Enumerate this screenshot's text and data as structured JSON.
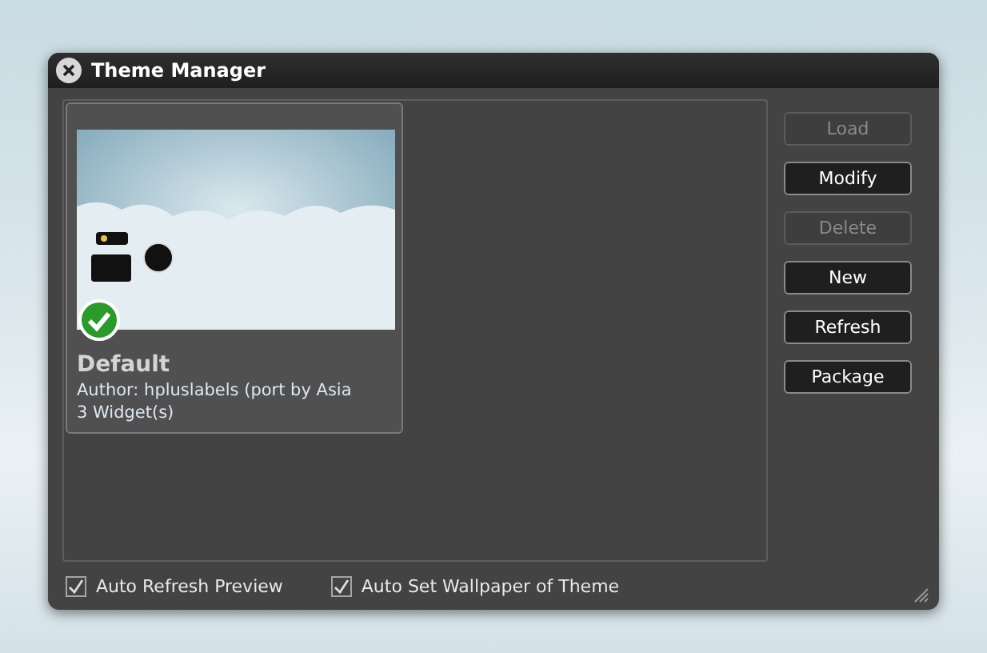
{
  "window": {
    "title": "Theme Manager"
  },
  "themes": [
    {
      "name": "Default",
      "author": "Author: hpluslabels (port by Asia",
      "widgets": "3 Widget(s)",
      "active": true,
      "selected": true
    }
  ],
  "buttons": [
    {
      "label": "Load",
      "disabled": true
    },
    {
      "label": "Modify",
      "disabled": false
    },
    {
      "label": "Delete",
      "disabled": true
    },
    {
      "label": "New",
      "disabled": false
    },
    {
      "label": "Refresh",
      "disabled": false
    },
    {
      "label": "Package",
      "disabled": false
    }
  ],
  "options": [
    {
      "label": "Auto Refresh Preview",
      "checked": true
    },
    {
      "label": "Auto Set Wallpaper of Theme",
      "checked": true
    }
  ]
}
